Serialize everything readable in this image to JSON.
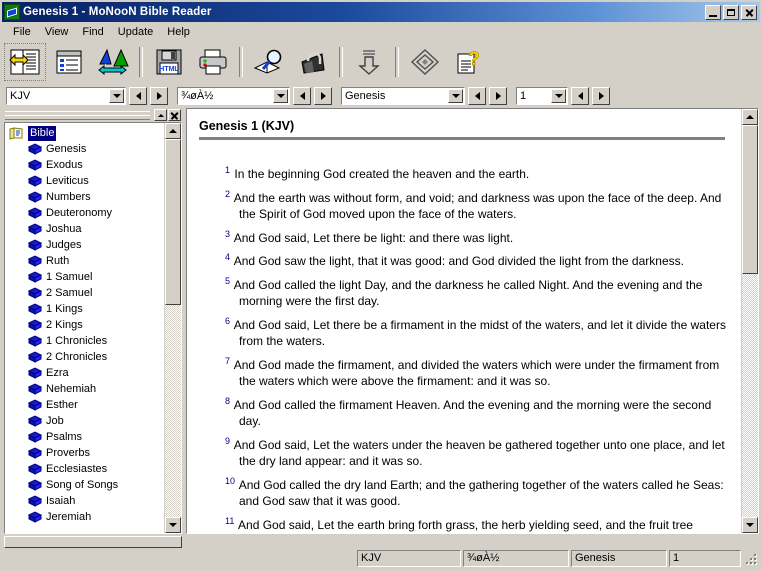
{
  "window": {
    "title": "Genesis 1 - MoNooN Bible Reader",
    "app_icon": "book-icon",
    "buttons": {
      "minimize": "minimize",
      "maximize": "maximize",
      "close": "close"
    }
  },
  "menu": {
    "items": [
      {
        "label": "File"
      },
      {
        "label": "View"
      },
      {
        "label": "Find"
      },
      {
        "label": "Update"
      },
      {
        "label": "Help"
      }
    ]
  },
  "toolbar": {
    "buttons": [
      {
        "name": "parallel-view-icon",
        "tip": "Parallel View"
      },
      {
        "name": "list-view-icon",
        "tip": "List View"
      },
      {
        "name": "font-size-icon",
        "tip": "Font"
      },
      {
        "name": "save-html-icon",
        "tip": "Save as HTML"
      },
      {
        "name": "print-icon",
        "tip": "Print"
      },
      {
        "name": "search-book-icon",
        "tip": "Search"
      },
      {
        "name": "bookmark-clip-icon",
        "tip": "Bookmarks"
      },
      {
        "name": "download-icon",
        "tip": "Download"
      },
      {
        "name": "diamond-icon",
        "tip": "Options"
      },
      {
        "name": "help-icon",
        "tip": "Help"
      }
    ]
  },
  "combobar": {
    "version_combo": {
      "value": "KJV",
      "name": "version-combo"
    },
    "module_combo": {
      "value": "¾øÀ½",
      "name": "module-combo"
    },
    "book_combo": {
      "value": "Genesis",
      "name": "book-combo"
    },
    "chapter_combo": {
      "value": "1",
      "name": "chapter-combo"
    },
    "prev_label": "previous",
    "next_label": "next"
  },
  "dock": {
    "title": "",
    "rollup_label": "roll-up",
    "close_label": "close",
    "tree": {
      "root": {
        "label": "Bible",
        "icon": "folder-book-icon",
        "selected": true
      },
      "items": [
        {
          "label": "Genesis"
        },
        {
          "label": "Exodus"
        },
        {
          "label": "Leviticus"
        },
        {
          "label": "Numbers"
        },
        {
          "label": "Deuteronomy"
        },
        {
          "label": "Joshua"
        },
        {
          "label": "Judges"
        },
        {
          "label": "Ruth"
        },
        {
          "label": "1 Samuel"
        },
        {
          "label": "2 Samuel"
        },
        {
          "label": "1 Kings"
        },
        {
          "label": "2 Kings"
        },
        {
          "label": "1 Chronicles"
        },
        {
          "label": "2 Chronicles"
        },
        {
          "label": "Ezra"
        },
        {
          "label": "Nehemiah"
        },
        {
          "label": "Esther"
        },
        {
          "label": "Job"
        },
        {
          "label": "Psalms"
        },
        {
          "label": "Proverbs"
        },
        {
          "label": "Ecclesiastes"
        },
        {
          "label": "Song of Songs"
        },
        {
          "label": "Isaiah"
        },
        {
          "label": "Jeremiah"
        }
      ]
    }
  },
  "text_view": {
    "heading": "Genesis 1 (KJV)",
    "verses": [
      {
        "num": "1",
        "text": "In the beginning God created the heaven and the earth."
      },
      {
        "num": "2",
        "text": "And the earth was without form, and void; and darkness was upon the face of the deep. And the Spirit of God moved upon the face of the waters."
      },
      {
        "num": "3",
        "text": "And God said, Let there be light: and there was light."
      },
      {
        "num": "4",
        "text": "And God saw the light, that it was good: and God divided the light from the darkness."
      },
      {
        "num": "5",
        "text": "And God called the light Day, and the darkness he called Night. And the evening and the morning were the first day."
      },
      {
        "num": "6",
        "text": "And God said, Let there be a firmament in the midst of the waters, and let it divide the waters from the waters."
      },
      {
        "num": "7",
        "text": "And God made the firmament, and divided the waters which were under the firmament from the waters which were above the firmament: and it was so."
      },
      {
        "num": "8",
        "text": "And God called the firmament Heaven. And the evening and the morning were the second day."
      },
      {
        "num": "9",
        "text": "And God said, Let the waters under the heaven be gathered together unto one place, and let the dry land appear: and it was so."
      },
      {
        "num": "10",
        "text": "And God called the dry land Earth; and the gathering together of the waters called he Seas: and God saw that it was good."
      },
      {
        "num": "11",
        "text": "And God said, Let the earth bring forth grass, the herb yielding seed, and the fruit tree yielding fruit after his kind, whose seed is in itself, upon the earth: and it was"
      }
    ]
  },
  "statusbar": {
    "panels": [
      {
        "name": "status-version",
        "value": "KJV"
      },
      {
        "name": "status-module",
        "value": "¾øÀ½"
      },
      {
        "name": "status-book",
        "value": "Genesis"
      },
      {
        "name": "status-chapter",
        "value": "1"
      }
    ]
  },
  "colors": {
    "title_start": "#0a246a",
    "title_end": "#a6c8ea",
    "face": "#d4d0c8",
    "verse_number": "#00008b",
    "selection": "#000080"
  }
}
